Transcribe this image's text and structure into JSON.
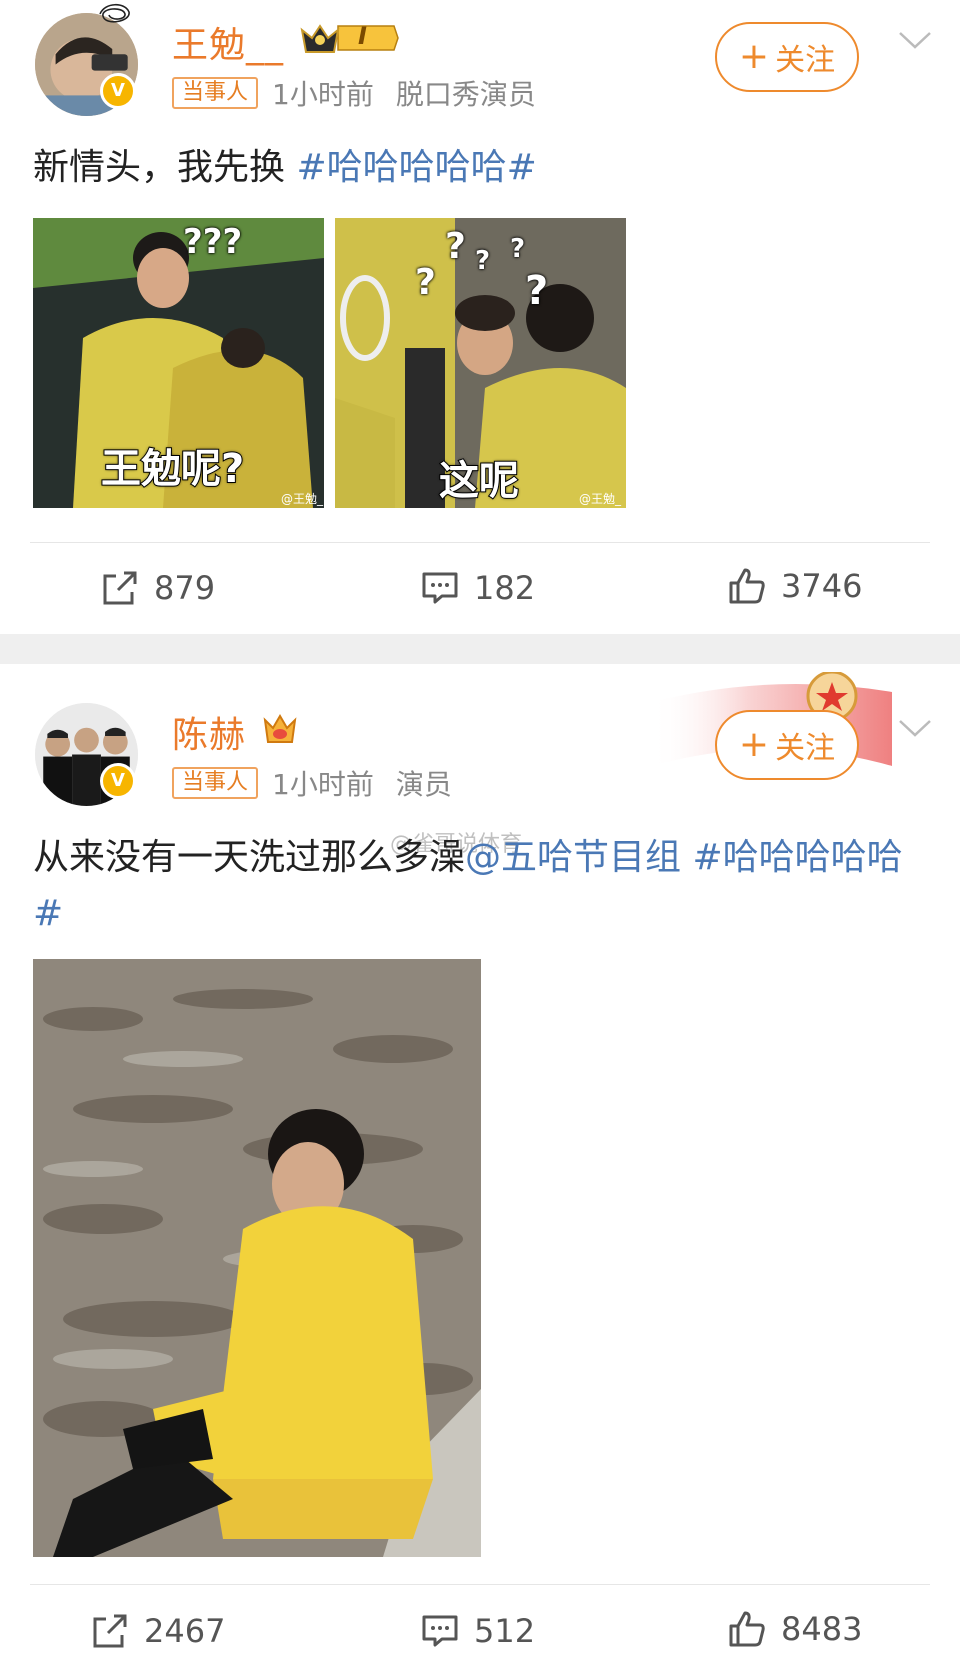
{
  "posts": [
    {
      "username": "王勉__",
      "level_badge": "I",
      "party_tag": "当事人",
      "time": "1小时前",
      "profession": "脱口秀演员",
      "follow_label": "关注",
      "follow_plus": "+",
      "text": "新情头，我先换",
      "hashtag": "#哈哈哈哈哈#",
      "images": [
        {
          "caption": "王勉呢?",
          "marks": "???",
          "watermark": "@王勉_"
        },
        {
          "caption": "这呢",
          "marks": "?",
          "watermark": "@王勉_"
        }
      ],
      "actions": {
        "repost": "879",
        "comment": "182",
        "like": "3746"
      }
    },
    {
      "username": "陈赫",
      "party_tag": "当事人",
      "time": "1小时前",
      "profession": "演员",
      "follow_label": "关注",
      "follow_plus": "+",
      "text": "从来没有一天洗过那么多澡",
      "mention": "@五哈节目组",
      "hashtag": "#哈哈哈哈哈#",
      "watermark": "@雀哥说体育",
      "actions": {
        "repost": "2467",
        "comment": "512",
        "like": "8483"
      }
    }
  ],
  "icons": {
    "repost": "repost-icon",
    "comment": "comment-icon",
    "like": "thumbs-up-icon",
    "verified": "verified-v-icon",
    "more": "chevron-down-icon"
  },
  "colors": {
    "username": "#ea7a2b",
    "follow": "#ee8a2d",
    "link": "#4a78b5",
    "verified": "#f7b500"
  }
}
